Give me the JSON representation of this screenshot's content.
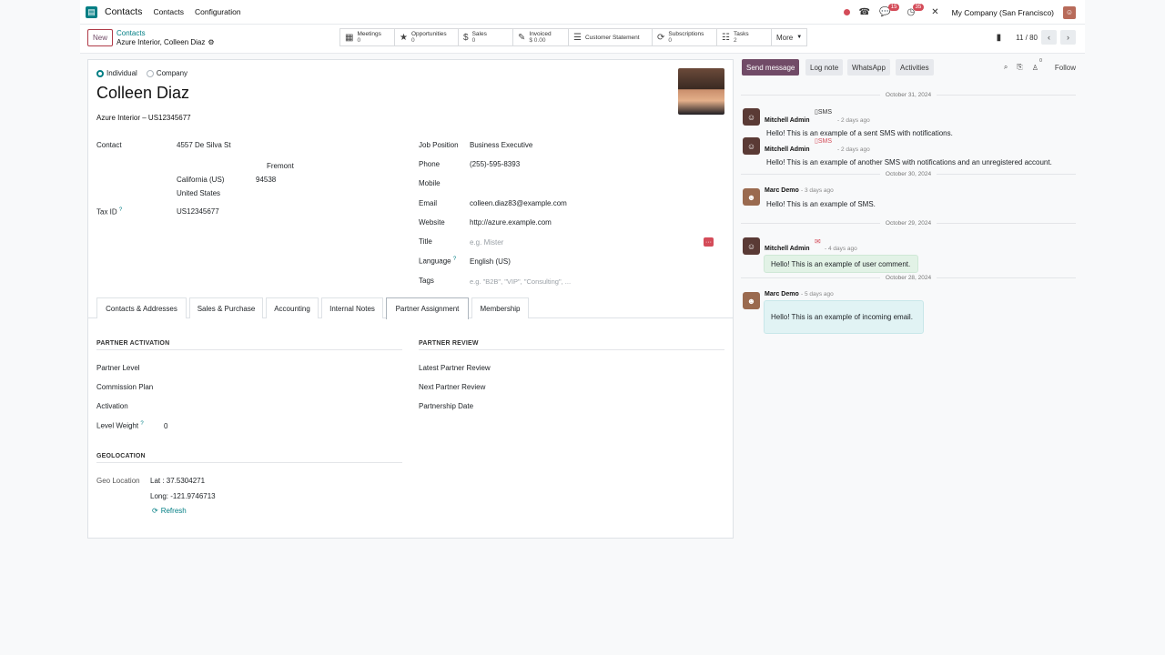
{
  "topnav": {
    "app_name": "Contacts",
    "menu": [
      "Contacts",
      "Configuration"
    ],
    "messages_count": "15",
    "activities_count": "35",
    "company": "My Company (San Francisco)"
  },
  "control_panel": {
    "new_label": "New",
    "breadcrumb_parent": "Contacts",
    "breadcrumb_current": "Azure Interior, Colleen Diaz",
    "smart_buttons": [
      {
        "label": "Meetings",
        "value": "0",
        "icon": "calendar-icon"
      },
      {
        "label": "Opportunities",
        "value": "0",
        "icon": "star-icon"
      },
      {
        "label": "Sales",
        "value": "0",
        "icon": "dollar-icon"
      },
      {
        "label": "Invoiced",
        "value": "$ 0.00",
        "icon": "invoice-icon"
      },
      {
        "label": "Customer Statement",
        "value": "",
        "icon": "list-icon"
      },
      {
        "label": "Subscriptions",
        "value": "0",
        "icon": "refresh-icon"
      },
      {
        "label": "Tasks",
        "value": "2",
        "icon": "tasks-icon"
      }
    ],
    "more_label": "More",
    "pager": "11 / 80"
  },
  "form": {
    "type_individual": "Individual",
    "type_company": "Company",
    "name": "Colleen Diaz",
    "company_line": "Azure Interior – US12345677",
    "contact_label": "Contact",
    "street": "4557 De Silva St",
    "city": "Fremont",
    "state": "California (US)",
    "zip": "94538",
    "country": "United States",
    "tax_id_label": "Tax ID",
    "tax_id": "US12345677",
    "job_position_label": "Job Position",
    "job_position": "Business Executive",
    "phone_label": "Phone",
    "phone": "(255)-595-8393",
    "mobile_label": "Mobile",
    "email_label": "Email",
    "email": "colleen.diaz83@example.com",
    "website_label": "Website",
    "website": "http://azure.example.com",
    "title_label": "Title",
    "title_placeholder": "e.g. Mister",
    "language_label": "Language",
    "language": "English (US)",
    "tags_label": "Tags",
    "tags_placeholder": "e.g. \"B2B\", \"VIP\", \"Consulting\", ..."
  },
  "tabs": [
    "Contacts & Addresses",
    "Sales & Purchase",
    "Accounting",
    "Internal Notes",
    "Partner Assignment",
    "Membership"
  ],
  "active_tab": "Partner Assignment",
  "partner": {
    "activation_title": "PARTNER ACTIVATION",
    "partner_level_label": "Partner Level",
    "commission_plan_label": "Commission Plan",
    "activation_label": "Activation",
    "level_weight_label": "Level Weight",
    "level_weight": "0",
    "review_title": "PARTNER REVIEW",
    "latest_review_label": "Latest Partner Review",
    "next_review_label": "Next Partner Review",
    "partnership_date_label": "Partnership Date",
    "geo_title": "GEOLOCATION",
    "geo_label": "Geo Location",
    "lat": "Lat : 37.5304271",
    "long": "Long: -121.9746713",
    "refresh_label": "Refresh"
  },
  "chatter": {
    "send_message": "Send message",
    "log_note": "Log note",
    "whatsapp": "WhatsApp",
    "activities": "Activities",
    "followers_count": "0",
    "follow": "Follow",
    "dates": [
      "October 31, 2024",
      "October 30, 2024",
      "October 29, 2024",
      "October 28, 2024"
    ],
    "messages": [
      {
        "author": "Mitchell Admin",
        "time": "- 2 days ago",
        "tag": "SMS",
        "body": "Hello! This is an example of a sent SMS with notifications."
      },
      {
        "author": "Mitchell Admin",
        "time": "- 2 days ago",
        "tag": "SMS",
        "body": "Hello! This is an example of another SMS with notifications and an unregistered account."
      },
      {
        "author": "Marc Demo",
        "time": "- 3 days ago",
        "body": "Hello! This is an example of SMS."
      },
      {
        "author": "Mitchell Admin",
        "time": "- 4 days ago",
        "body": "Hello! This is an example of user comment."
      },
      {
        "author": "Marc Demo",
        "time": "- 5 days ago",
        "body": "Hello! This is an example of incoming email."
      }
    ]
  },
  "colors": {
    "primary": "#714b67",
    "accent": "#017e84",
    "danger": "#d44c59"
  }
}
